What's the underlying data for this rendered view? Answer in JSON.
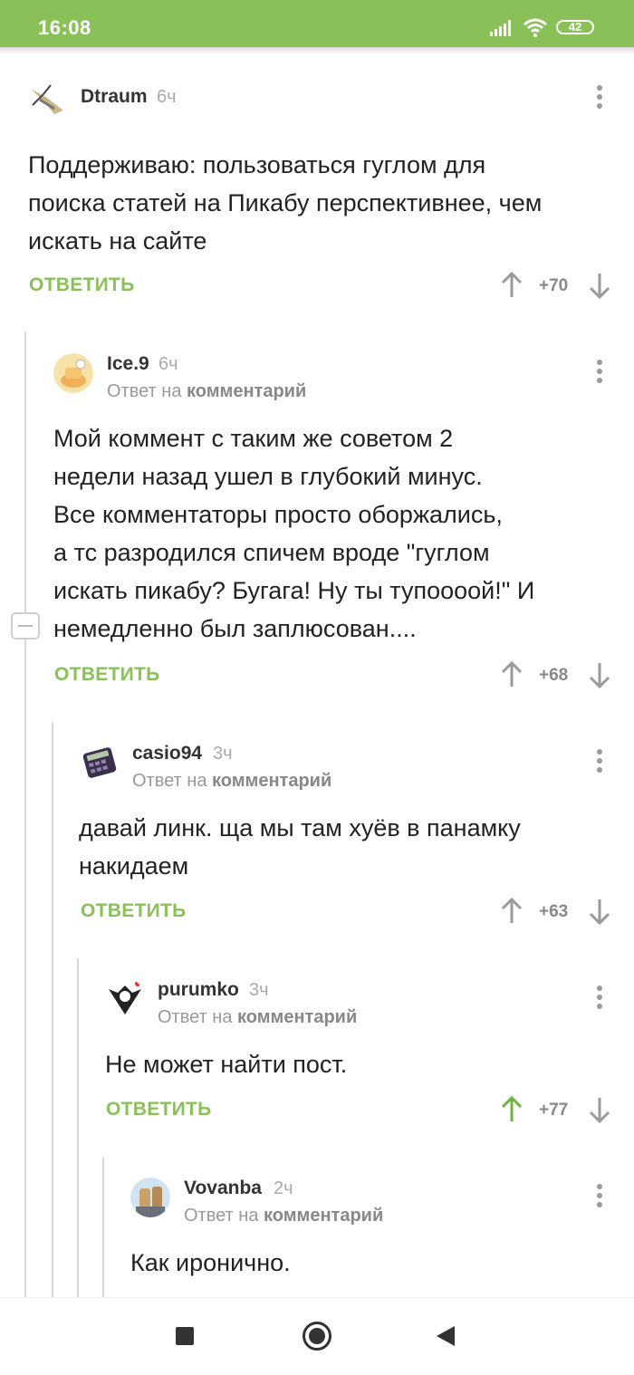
{
  "status_bar": {
    "time": "16:08",
    "battery": "42"
  },
  "comments": [
    {
      "author": "Dtraum",
      "time": "6ч",
      "text_lines": [
        "Поддерживаю: пользоваться гуглом для",
        "поиска статей на Пикабу перспективнее, чем",
        "искать на сайте"
      ],
      "reply_label": "ОТВЕТИТЬ",
      "rating": "+70"
    },
    {
      "author": "Ice.9",
      "time": "6ч",
      "reply_to_prefix": "Ответ на",
      "reply_to_link": "комментарий",
      "text_lines": [
        "Мой коммент с таким же советом 2",
        "недели назад ушел в глубокий минус.",
        "Все комментаторы просто оборжались,",
        "а тс разродился спичем вроде \"гуглом",
        "искать пикабу? Бугага! Ну ты тупоооой!\" И",
        "немедленно был заплюсован...."
      ],
      "reply_label": "ОТВЕТИТЬ",
      "rating": "+68"
    },
    {
      "author": "casio94",
      "time": "3ч",
      "reply_to_prefix": "Ответ на",
      "reply_to_link": "комментарий",
      "text_lines": [
        "давай линк. ща мы там хуёв в панамку",
        "накидаем"
      ],
      "reply_label": "ОТВЕТИТЬ",
      "rating": "+63"
    },
    {
      "author": "purumko",
      "time": "3ч",
      "reply_to_prefix": "Ответ на",
      "reply_to_link": "комментарий",
      "text_lines": [
        "Не может найти пост."
      ],
      "reply_label": "ОТВЕТИТЬ",
      "rating": "+77",
      "upvoted": true
    },
    {
      "author": "Vovanba",
      "time": "2ч",
      "reply_to_prefix": "Ответ на",
      "reply_to_link": "комментарий",
      "text_lines": [
        "Как иронично."
      ]
    }
  ],
  "colors": {
    "accent": "#8ac058",
    "upvoted_arrow": "#6cb33f",
    "arrow": "#9a9a9a"
  },
  "icons": [
    "signal-icon",
    "wifi-icon",
    "battery-icon",
    "more-vertical-icon",
    "arrow-up-icon",
    "arrow-down-icon",
    "collapse-icon",
    "nav-recents-icon",
    "nav-home-icon",
    "nav-back-icon"
  ]
}
